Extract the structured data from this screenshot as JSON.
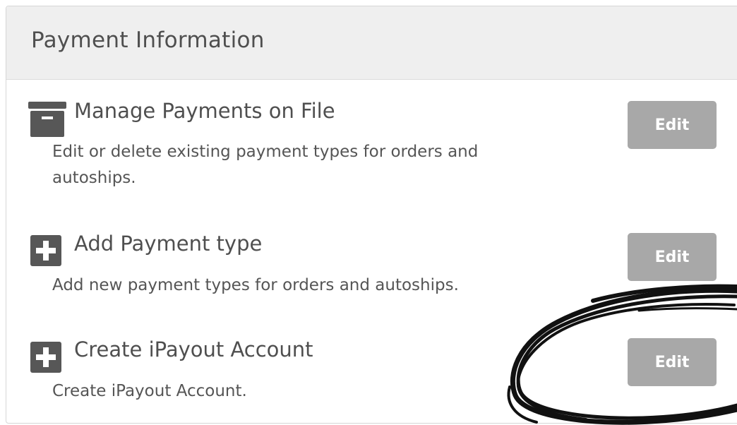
{
  "panel": {
    "title": "Payment Information"
  },
  "rows": [
    {
      "icon": "archive-box-icon",
      "title": "Manage Payments on File",
      "description": "Edit or delete existing payment types for orders and autoships.",
      "button_label": "Edit"
    },
    {
      "icon": "plus-square-icon",
      "title": "Add Payment type",
      "description": "Add new payment types for orders and autoships.",
      "button_label": "Edit"
    },
    {
      "icon": "plus-square-icon",
      "title": "Create iPayout Account",
      "description": "Create iPayout Account.",
      "button_label": "Edit"
    }
  ],
  "colors": {
    "header_bg": "#efefef",
    "button_bg": "#a8a8a8",
    "icon": "#575757",
    "text": "#4f4f4f"
  }
}
